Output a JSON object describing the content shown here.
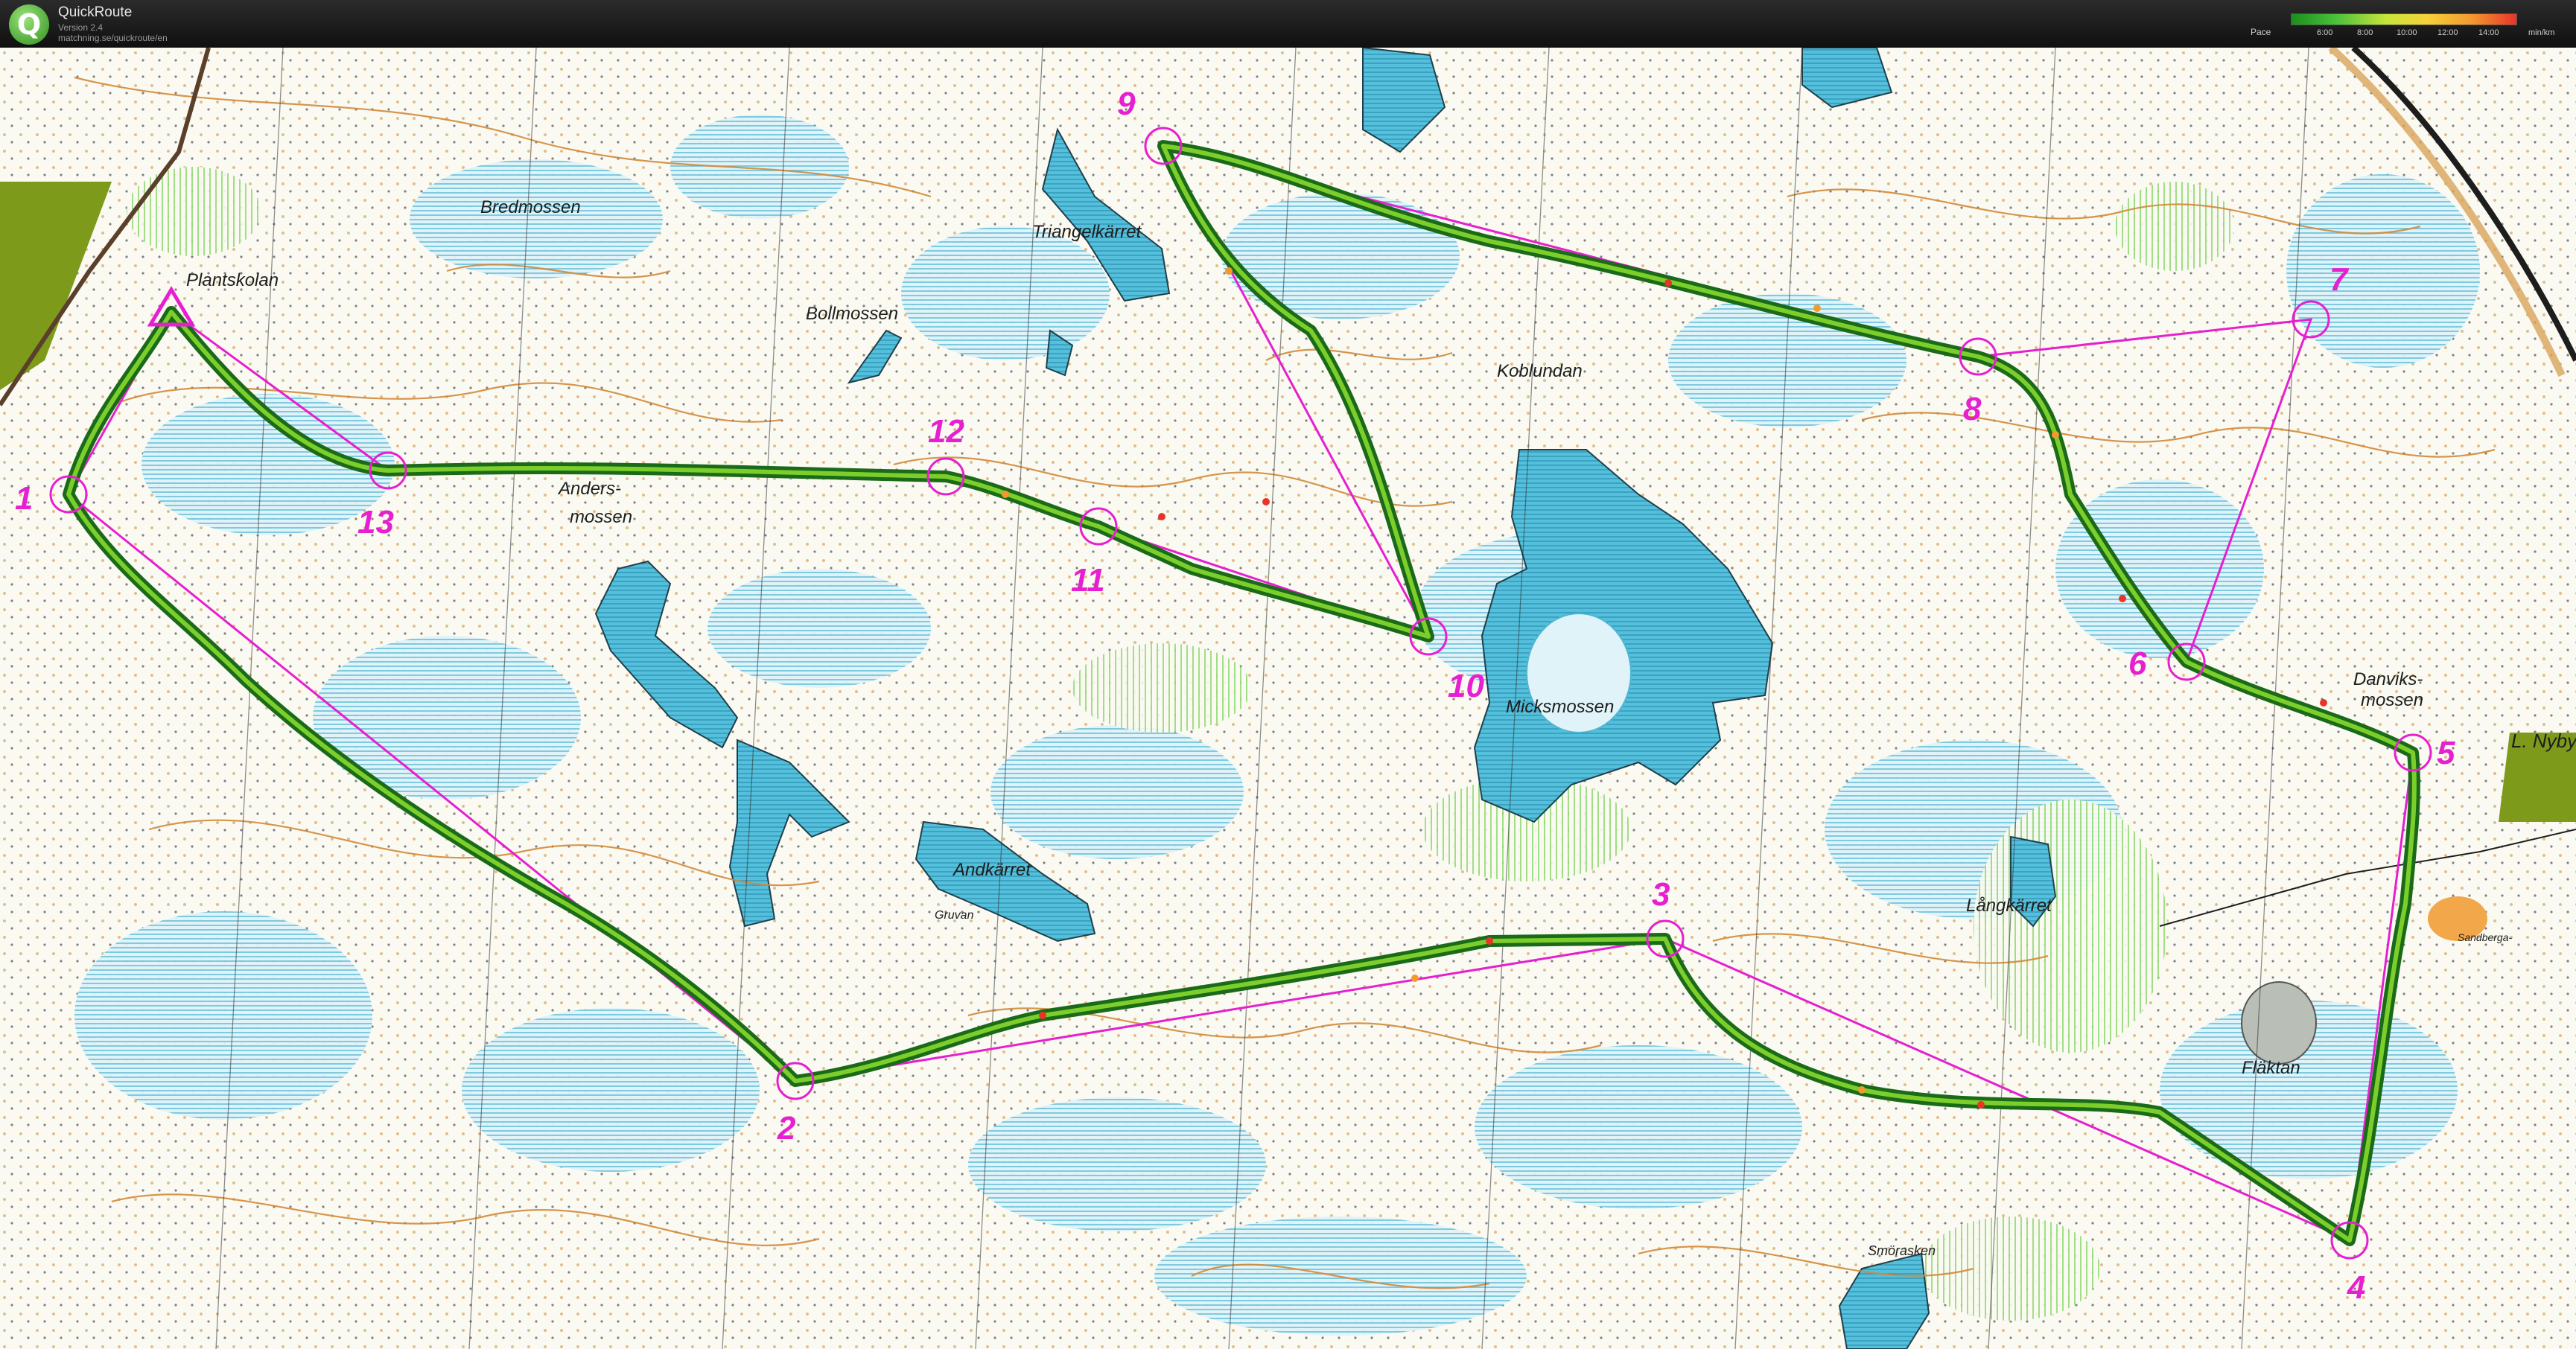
{
  "window": {
    "app_name": "QuickRoute",
    "version": "Version 2.4",
    "url": "matchning.se/quickroute/en",
    "logo_letter": "Q"
  },
  "legend": {
    "label": "Pace",
    "unit": "min/km",
    "ticks": [
      "6:00",
      "8:00",
      "10:00",
      "12:00",
      "14:00"
    ]
  },
  "colors": {
    "control": "#e61fd0",
    "route_outline": "#1a6a1a",
    "route_core": "#7ccf2a",
    "water": "#5fc3dc",
    "marsh": "#a8dcea",
    "forest_white": "#fbfaf2",
    "contour": "#d99a4a",
    "open_green": "#7fd35f",
    "olive": "#7d9a1b"
  },
  "map": {
    "place_names": [
      "Bredmossen",
      "Plantskolan",
      "Bollmossen",
      "Triangelkärret",
      "Koblundan",
      "Anders-",
      "mossen",
      "Micksmossen",
      "Andkärret",
      "Gruvan",
      "Långkärret",
      "Danviks-",
      "mossen",
      "L. Nyby",
      "Sandberga-",
      "Fläktan",
      "Smörasken"
    ],
    "controls": [
      {
        "id": "1",
        "label": "1"
      },
      {
        "id": "2",
        "label": "2"
      },
      {
        "id": "3",
        "label": "3"
      },
      {
        "id": "4",
        "label": "4"
      },
      {
        "id": "5",
        "label": "5"
      },
      {
        "id": "6",
        "label": "6"
      },
      {
        "id": "7",
        "label": "7"
      },
      {
        "id": "8",
        "label": "8"
      },
      {
        "id": "9",
        "label": "9"
      },
      {
        "id": "10",
        "label": "10"
      },
      {
        "id": "11",
        "label": "11"
      },
      {
        "id": "12",
        "label": "12"
      },
      {
        "id": "13",
        "label": "13"
      }
    ]
  }
}
